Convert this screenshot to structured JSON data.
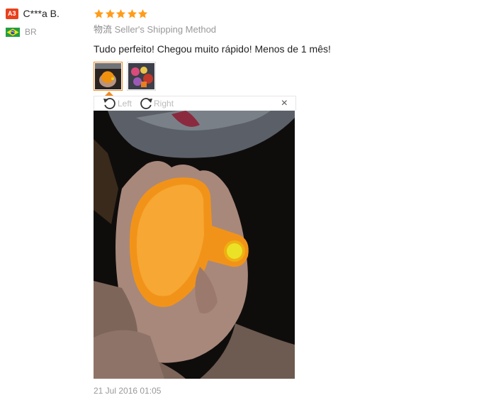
{
  "user": {
    "level_badge": "A3",
    "name": "C***a B.",
    "country_code": "BR"
  },
  "review": {
    "rating": 5,
    "shipping_prefix": "物流",
    "shipping_method": "Seller's Shipping Method",
    "comment": "Tudo perfeito! Chegou muito rápido! Menos de 1 mês!",
    "date": "21 Jul 2016 01:05"
  },
  "viewer": {
    "rotate_left_label": "Left",
    "rotate_right_label": "Right",
    "close_symbol": "×"
  },
  "colors": {
    "star": "#ff9c1a",
    "badge": "#e8411c",
    "accent": "#f08a24"
  },
  "icons": [
    "brazil-flag-icon",
    "star-icon",
    "rotate-left-icon",
    "rotate-right-icon",
    "close-icon"
  ]
}
